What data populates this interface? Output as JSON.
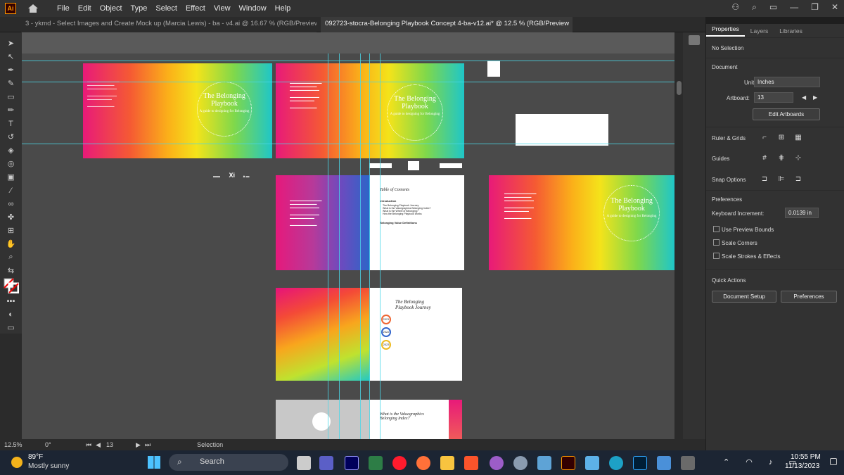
{
  "app": {
    "logo": "Ai"
  },
  "menu": [
    "File",
    "Edit",
    "Object",
    "Type",
    "Select",
    "Effect",
    "View",
    "Window",
    "Help"
  ],
  "tabs": [
    {
      "label": "3 - ykmd - Select Images and Create Mock up (Marcia Lewis) - ba - v4.ai @ 16.67 % (RGB/Preview"
    },
    {
      "label": "092723-stocra-Belonging Playbook Concept 4-ba-v12.ai* @ 12.5 % (RGB/Preview",
      "close": "✕"
    }
  ],
  "artboards": {
    "playbook_title": "The Belonging Playbook",
    "playbook_sub": "A guide to designing for Belonging",
    "toc_title": "Table of Contents",
    "toc_intro": "Introduction",
    "toc_items": [
      "The Belonging Playbook Journey",
      "What is the Valuegraphics Belonging Index?",
      "What is the Wheel of Belonging?",
      "How the Belonging Playbook Works"
    ],
    "toc_defs": "Belonging Value Definitions",
    "journey_title": "The Belonging Playbook Journey",
    "journey_years": [
      "2021",
      "2022",
      "2023"
    ],
    "index_title": "What is the Valuegraphics Belonging Index?"
  },
  "status": {
    "zoom": "12.5%",
    "angle": "0°",
    "artboard": "13",
    "tool": "Selection"
  },
  "panel": {
    "tabs": [
      "Properties",
      "Layers",
      "Libraries"
    ],
    "selection": "No Selection",
    "document": "Document",
    "units_label": "Units:",
    "units": "Inches",
    "artboard_label": "Artboard:",
    "artboard": "13",
    "edit_artboards": "Edit Artboards",
    "rulers": "Ruler & Grids",
    "guides": "Guides",
    "snap": "Snap Options",
    "preferences": "Preferences",
    "kb_label": "Keyboard Increment:",
    "kb_value": "0.0139 in",
    "checks": [
      "Use Preview Bounds",
      "Scale Corners",
      "Scale Strokes & Effects"
    ],
    "quick": "Quick Actions",
    "doc_setup": "Document Setup",
    "prefs_btn": "Preferences"
  },
  "taskbar": {
    "temp": "89°F",
    "weather": "Mostly sunny",
    "search": "Search",
    "time": "10:55 PM",
    "date": "11/13/2023"
  }
}
